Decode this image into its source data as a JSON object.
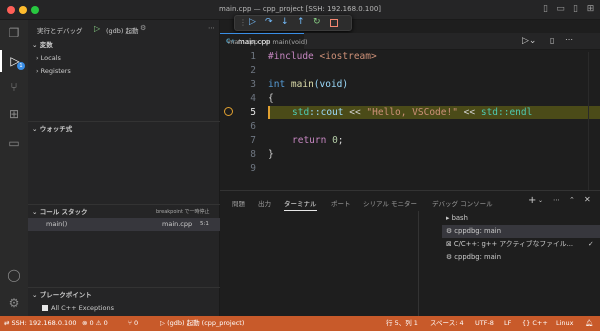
{
  "window": {
    "title": "main.cpp — cpp_project [SSH: 192.168.0.100]"
  },
  "activity": {
    "debug_badge": "1"
  },
  "sidebar": {
    "run_label": "実行とデバッグ",
    "config_name": "(gdb) 起動",
    "variables_header": "変数",
    "locals": "Locals",
    "registers": "Registers",
    "watch_header": "ウォッチ式",
    "callstack_header": "コール スタック",
    "callstack_status": "breakpoint で一時停止",
    "frame_name": "main()",
    "frame_file": "main.cpp",
    "frame_pos": "5:1",
    "breakpoints_header": "ブレークポイント",
    "bp_all_cpp": "All C++ Exceptions"
  },
  "editor": {
    "tab_label": "main.cpp",
    "breadcrumb_file": "main.cpp",
    "breadcrumb_symbol": "main(void)",
    "lines": [
      {
        "n": "1"
      },
      {
        "n": "2"
      },
      {
        "n": "3"
      },
      {
        "n": "4"
      },
      {
        "n": "5"
      },
      {
        "n": "6"
      },
      {
        "n": "7"
      },
      {
        "n": "8"
      },
      {
        "n": "9"
      }
    ],
    "code": {
      "l1_directive": "#include",
      "l1_header": "<iostream>",
      "l3_type": "int",
      "l3_fn": "main",
      "l3_param": "(void)",
      "l4": "{",
      "l5_ns": "std",
      "l5_cout": "::cout",
      "l5_op1": "<<",
      "l5_str": "\"Hello, VSCode!\"",
      "l5_op2": "<<",
      "l5_endl": "std::endl",
      "l7_kw": "return",
      "l7_num": "0",
      "l7_semi": ";",
      "l8": "}"
    }
  },
  "panel": {
    "tabs": [
      "問題",
      "出力",
      "ターミナル",
      "ポート",
      "シリアル モニター",
      "デバッグ コンソール"
    ],
    "active_tab_index": 2,
    "terminals": [
      {
        "label": "bash"
      },
      {
        "label": "cppdbg: main"
      },
      {
        "label": "C/C++: g++ アクティブなファイル..."
      },
      {
        "label": "cppdbg: main"
      }
    ]
  },
  "statusbar": {
    "remote": "SSH: 192.168.0.100",
    "errors": "0",
    "warnings": "0",
    "ports": "0",
    "debug_config": "(gdb) 起動 (cpp_project)",
    "position": "行 5、列 1",
    "spaces": "スペース: 4",
    "encoding": "UTF-8",
    "eol": "LF",
    "language": "C++",
    "os": "Linux"
  },
  "colors": {
    "statusbar_bg": "#c85a2a",
    "current_line_bg": "#4b4b18",
    "breakpoint": "#e0a030"
  }
}
